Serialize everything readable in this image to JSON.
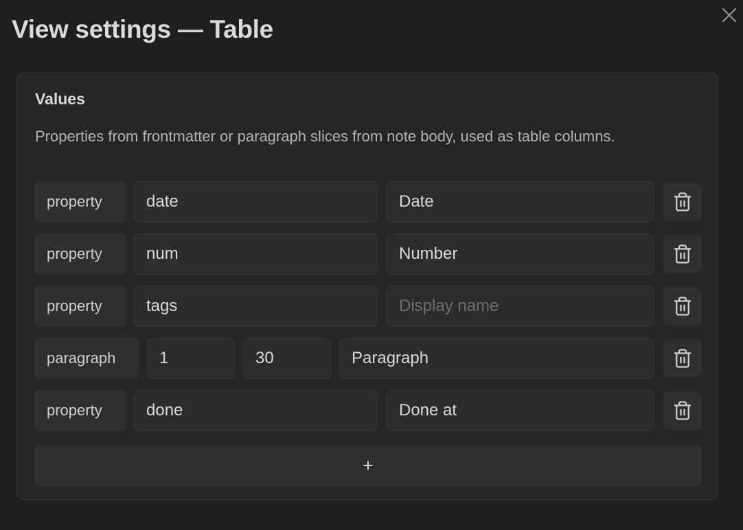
{
  "title": "View settings — Table",
  "card": {
    "title": "Values",
    "description": "Properties from frontmatter or paragraph slices from note body, used as table columns."
  },
  "rows": [
    {
      "type": "property",
      "key": "date",
      "display": "Date",
      "placeholder": "Display name"
    },
    {
      "type": "property",
      "key": "num",
      "display": "Number",
      "placeholder": "Display name"
    },
    {
      "type": "property",
      "key": "tags",
      "display": "",
      "placeholder": "Display name"
    },
    {
      "type": "paragraph",
      "from": "1",
      "to": "30",
      "display": "Paragraph",
      "placeholder": "Display name"
    },
    {
      "type": "property",
      "key": "done",
      "display": "Done at",
      "placeholder": "Display name"
    }
  ],
  "add_label": "+",
  "colors": {
    "background": "#1e1e1e",
    "card": "#262626",
    "field": "#2c2c2c",
    "tag": "#2f2f2f",
    "text": "#dadada",
    "muted": "#b3b3b3",
    "placeholder": "#6e6e6e"
  },
  "icons": {
    "close": "close-icon",
    "delete": "trash-icon"
  }
}
